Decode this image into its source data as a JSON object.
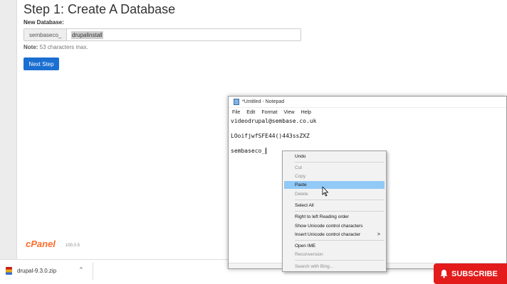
{
  "page": {
    "title": "Step 1: Create A Database",
    "db_label": "New Database:",
    "db_prefix": "sembaseco_",
    "db_value": "drupalinstall",
    "note_label": "Note:",
    "note_text": " 53 characters max.",
    "next_button": "Next Step"
  },
  "footer": {
    "logo": "cPanel",
    "version": "100.0.5"
  },
  "downloads": {
    "file_name": "drupal-9.3.0.zip",
    "chevron": "^"
  },
  "notepad": {
    "title": "*Untitled - Notepad",
    "menu": [
      "File",
      "Edit",
      "Format",
      "View",
      "Help"
    ],
    "lines": [
      "videodrupal@sembase.co.uk",
      "",
      "LOoifjwfSFE44()443ssZXZ",
      "",
      "sembaseco_"
    ]
  },
  "context_menu": {
    "items": [
      {
        "label": "Undo"
      },
      {
        "label": "Cut"
      },
      {
        "label": "Copy"
      },
      {
        "label": "Paste"
      },
      {
        "label": "Delete"
      },
      {
        "label": "Select All"
      },
      {
        "label": "Right to left Reading order"
      },
      {
        "label": "Show Unicode control characters"
      },
      {
        "label": "Insert Unicode control character"
      },
      {
        "label": "Open IME"
      },
      {
        "label": "Reconversion"
      },
      {
        "label": "Search with Bing..."
      }
    ],
    "submenu_arrow": ">"
  },
  "subscribe": {
    "label": "SUBSCRIBE"
  },
  "colors": {
    "button_blue": "#1a6fd1",
    "cpanel_orange": "#ff6c2c",
    "subscribe_red": "#e31b1b",
    "menu_highlight": "#91c9f7"
  }
}
